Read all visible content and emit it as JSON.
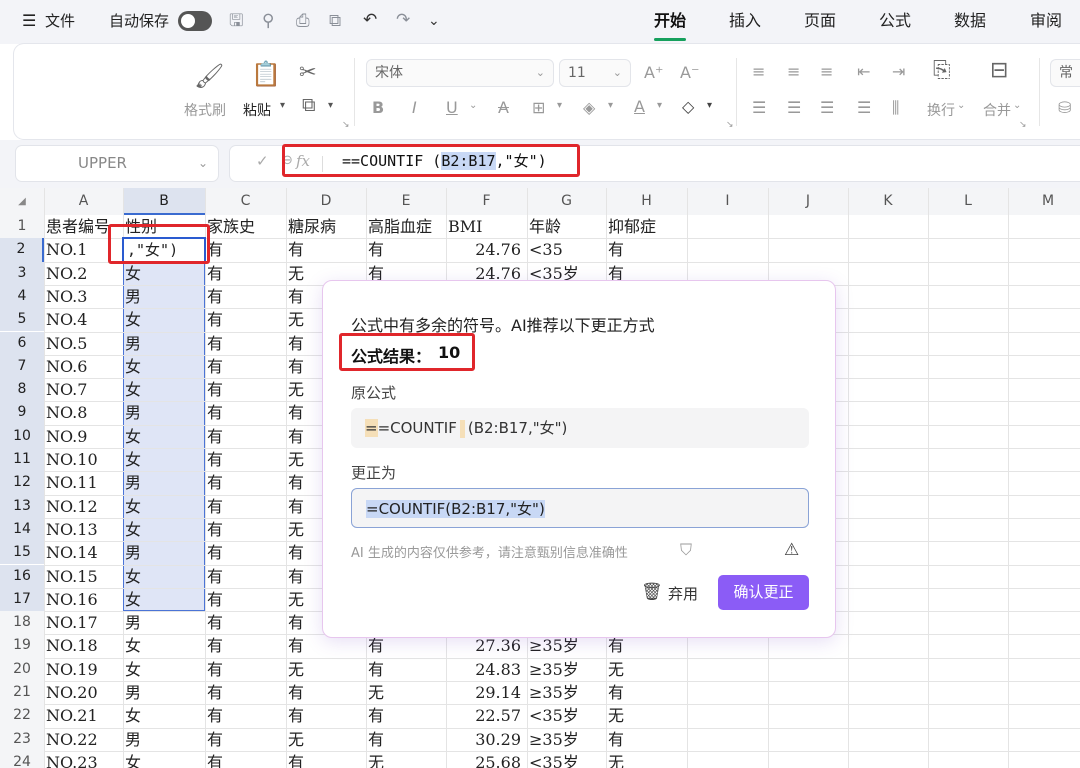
{
  "topbar": {
    "menu_icon": "hamburger-icon",
    "file_label": "文件",
    "autosave_label": "自动保存",
    "autosave_on": false,
    "tabs": [
      {
        "label": "开始",
        "active": true
      },
      {
        "label": "插入",
        "active": false
      },
      {
        "label": "页面",
        "active": false
      },
      {
        "label": "公式",
        "active": false
      },
      {
        "label": "数据",
        "active": false
      },
      {
        "label": "审阅",
        "active": false
      }
    ]
  },
  "ribbon": {
    "format_painter": "格式刷",
    "paste": "粘贴",
    "font_name": "宋体",
    "font_size": "11",
    "wrap": "换行",
    "merge": "合并",
    "style_cut": "常"
  },
  "formula_bar": {
    "name_box": "UPPER",
    "fx_label": "fx",
    "formula_prefix": "==COUNTIF (",
    "formula_ref": "B2:B17",
    "formula_suffix": ",\"女\")"
  },
  "sheet": {
    "columns": [
      "A",
      "B",
      "C",
      "D",
      "E",
      "F",
      "G",
      "H",
      "I",
      "J",
      "K",
      "L",
      "M"
    ],
    "active_cell_text": ",\"女\")",
    "rows": [
      {
        "n": "1",
        "cells": [
          "患者编号",
          "性别",
          "家族史",
          "糖尿病",
          "高脂血症",
          "BMI",
          "年龄",
          "抑郁症"
        ]
      },
      {
        "n": "2",
        "cells": [
          "NO.1",
          "",
          "有",
          "有",
          "有",
          "24.76",
          "<35",
          "有"
        ]
      },
      {
        "n": "3",
        "cells": [
          "NO.2",
          "女",
          "有",
          "无",
          "有",
          "24.76",
          "<35岁",
          "有"
        ]
      },
      {
        "n": "4",
        "cells": [
          "NO.3",
          "男",
          "有",
          "有",
          "",
          "",
          "",
          ""
        ]
      },
      {
        "n": "5",
        "cells": [
          "NO.4",
          "女",
          "有",
          "无",
          "",
          "",
          "",
          ""
        ]
      },
      {
        "n": "6",
        "cells": [
          "NO.5",
          "男",
          "有",
          "有",
          "",
          "",
          "",
          ""
        ]
      },
      {
        "n": "7",
        "cells": [
          "NO.6",
          "女",
          "有",
          "有",
          "",
          "",
          "",
          ""
        ]
      },
      {
        "n": "8",
        "cells": [
          "NO.7",
          "女",
          "有",
          "无",
          "",
          "",
          "",
          ""
        ]
      },
      {
        "n": "9",
        "cells": [
          "NO.8",
          "男",
          "有",
          "有",
          "",
          "",
          "",
          ""
        ]
      },
      {
        "n": "10",
        "cells": [
          "NO.9",
          "女",
          "有",
          "有",
          "",
          "",
          "",
          ""
        ]
      },
      {
        "n": "11",
        "cells": [
          "NO.10",
          "女",
          "有",
          "无",
          "",
          "",
          "",
          ""
        ]
      },
      {
        "n": "12",
        "cells": [
          "NO.11",
          "男",
          "有",
          "有",
          "",
          "",
          "",
          ""
        ]
      },
      {
        "n": "13",
        "cells": [
          "NO.12",
          "女",
          "有",
          "有",
          "",
          "",
          "",
          ""
        ]
      },
      {
        "n": "14",
        "cells": [
          "NO.13",
          "女",
          "有",
          "无",
          "",
          "",
          "",
          ""
        ]
      },
      {
        "n": "15",
        "cells": [
          "NO.14",
          "男",
          "有",
          "有",
          "",
          "",
          "",
          ""
        ]
      },
      {
        "n": "16",
        "cells": [
          "NO.15",
          "女",
          "有",
          "有",
          "",
          "",
          "",
          ""
        ]
      },
      {
        "n": "17",
        "cells": [
          "NO.16",
          "女",
          "有",
          "无",
          "",
          "",
          "",
          ""
        ]
      },
      {
        "n": "18",
        "cells": [
          "NO.17",
          "男",
          "有",
          "有",
          "",
          "",
          "",
          ""
        ]
      },
      {
        "n": "19",
        "cells": [
          "NO.18",
          "女",
          "有",
          "有",
          "有",
          "27.36",
          "≥35岁",
          "有"
        ]
      },
      {
        "n": "20",
        "cells": [
          "NO.19",
          "女",
          "有",
          "无",
          "有",
          "24.83",
          "≥35岁",
          "无"
        ]
      },
      {
        "n": "21",
        "cells": [
          "NO.20",
          "男",
          "有",
          "有",
          "无",
          "29.14",
          "≥35岁",
          "有"
        ]
      },
      {
        "n": "22",
        "cells": [
          "NO.21",
          "女",
          "有",
          "有",
          "有",
          "22.57",
          "<35岁",
          "无"
        ]
      },
      {
        "n": "23",
        "cells": [
          "NO.22",
          "男",
          "有",
          "无",
          "有",
          "30.29",
          "≥35岁",
          "有"
        ]
      },
      {
        "n": "24",
        "cells": [
          "NO.23",
          "女",
          "有",
          "有",
          "无",
          "25.68",
          "<35岁",
          "无"
        ]
      }
    ]
  },
  "popup": {
    "title": "公式中有多余的符号。AI推荐以下更正方式",
    "result_label": "公式结果：",
    "result_value": "10",
    "original_label": "原公式",
    "original_extra": "=",
    "original_main": "=COUNTIF",
    "original_rest": "(B2:B17,\"女\")",
    "corrected_label": "更正为",
    "corrected_formula": "=COUNTIF(B2:B17,\"女\")",
    "disclaimer": "AI 生成的内容仅供参考，请注意甄别信息准确性",
    "discard_label": "弃用",
    "confirm_label": "确认更正",
    "accent_color": "#8b5cf6"
  }
}
